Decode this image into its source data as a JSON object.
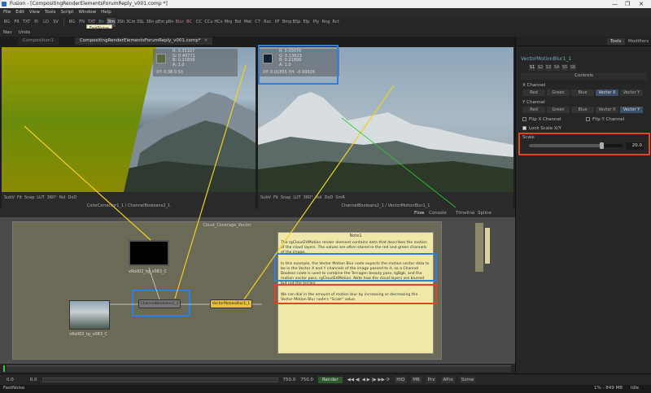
{
  "window": {
    "title": "Fusion - [CompositingRenderElementsForumReply_v001.comp *]",
    "min": "—",
    "max": "❐",
    "close": "✕"
  },
  "menu": [
    "File",
    "Edit",
    "View",
    "Tools",
    "Script",
    "Window",
    "Help"
  ],
  "toolbar": {
    "items": [
      "BG",
      "FR",
      "TXT",
      "PI",
      "LD",
      "SV",
      "BG",
      "FN",
      "TXT",
      "Bn",
      "3Im",
      "3Sh",
      "3Cm",
      "3SL",
      "3Rn",
      "pEm",
      "pRn",
      "Blur",
      "BC",
      "CC",
      "CCu",
      "HCv",
      "Mrg",
      "Bol",
      "Mat",
      "CT",
      "Rsz",
      "XF",
      "Bmp",
      "BSp",
      "Elp",
      "Ply",
      "Rng",
      "Rct"
    ],
    "selected_index": 10,
    "tooltip": "FastNoise"
  },
  "subbar": [
    "Nav",
    "Undo"
  ],
  "tabs": [
    {
      "label": "Composition1"
    },
    {
      "label": "CompositingRenderElementsForumReply_v001.comp*"
    }
  ],
  "viewer_left": {
    "readout": [
      "R: 0.35107",
      "G: 0.40771",
      "B: 0.21839",
      "A: 1.0"
    ],
    "coord": "XY: 0.38  0.53",
    "label": "ColorCorrector1_1 / ChannelBooleans2_1",
    "controls": [
      "SubV",
      "Fit",
      "Snap",
      "LUT",
      "360°",
      "RoI",
      "DoD"
    ]
  },
  "viewer_right": {
    "readout": [
      "R: 0.00076",
      "G: 0.13623",
      "B: 0.21899",
      "A: 1.0"
    ],
    "coord": "XY: 0.01855  YH: -0.00026",
    "label": "ChannelBooleans2_1 / VectorMotionBlur1_1",
    "controls": [
      "SubV",
      "Fit",
      "Snap",
      "LUT",
      "360°",
      "RoI",
      "DoD",
      "SmR"
    ]
  },
  "inspector": {
    "tabs": [
      "Tools",
      "Modifiers"
    ],
    "tool_name": "VectorMotionBlur1_1",
    "subtabs": [
      "S1",
      "S2",
      "S3",
      "S4",
      "S5",
      "S6"
    ],
    "section": "Controls",
    "x_channel_label": "X Channel",
    "y_channel_label": "Y Channel",
    "channels": [
      "Red",
      "Green",
      "Blue",
      "Vector X",
      "Vector Y"
    ],
    "x_selected": "Vector X",
    "y_selected": "Vector Y",
    "flip_x": "Flip X Channel",
    "flip_y": "Flip Y Channel",
    "lock_scale": "Lock Scale X/Y",
    "scale_label": "Scale",
    "scale_value": "20.0",
    "scale_fraction": 0.77
  },
  "node_editor": {
    "tabs": [
      "Flow",
      "Console",
      "Timeline",
      "Spline"
    ],
    "underlay_title": "Cloud_Coverage_Vector",
    "nodes": {
      "top": "vRoll02_tg_v083_C",
      "left": "vRoll02_tg_v083_C",
      "booleans": "ChannelBooleans2_1",
      "vmb": "VectorMotionBlur1_1"
    },
    "note": {
      "title": "Note1",
      "p1": "The rgCloud2dMotion render element contains data that describes the motion of the cloud layers.  The values are often stored in the red and green channels of the image.",
      "p2": "In this example, the Vector Motion Blur node expects the motion vector data to be in the Vector X and Y channels of the image passed to it, so a Channel Boolean node is used to combine the Terragen beauty pass, tgBgb, and the motion vector pass, rgCloud2dMotion.  Note how the cloud layers are blurred but not the terrain.",
      "p3": "We can dial in the amount of motion blur by increasing or decreasing the Vector Motion Blur node's \"Scale\" value."
    }
  },
  "timeline": {
    "start": "0.0",
    "ticks": [
      "0",
      "10",
      "20",
      "30",
      "40",
      "50",
      "60",
      "70",
      "80",
      "90",
      "100",
      "110",
      "120",
      "130",
      "140",
      "150",
      "160",
      "170",
      "180",
      "190",
      "200",
      "210",
      "220",
      "230",
      "240",
      "250"
    ]
  },
  "transport": {
    "cur": "0.0",
    "start2": "0.0",
    "end": "750.0",
    "end2": "750.0",
    "render": "Render",
    "buttons": [
      "HiQ",
      "MB",
      "Prx",
      "APrx",
      "Some"
    ]
  },
  "status": {
    "left": "FastNoise",
    "mem": "1% - 849 MB",
    "state": "Idle"
  }
}
